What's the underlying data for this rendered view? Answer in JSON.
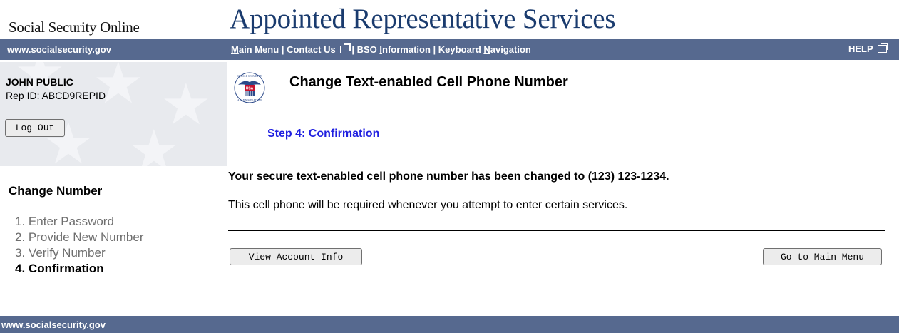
{
  "header": {
    "site_name": "Social Security Online",
    "app_title": "Appointed Representative Services"
  },
  "topbar": {
    "url": "www.socialsecurity.gov",
    "main_menu": "Main Menu",
    "contact_us": "Contact Us",
    "bso_information": "BSO Information",
    "keyboard_navigation": "Keyboard Navigation",
    "separator": "|",
    "help": "HELP"
  },
  "user": {
    "name": "JOHN PUBLIC",
    "rep_id": "Rep ID: ABCD9REPID",
    "logout_label": "Log Out"
  },
  "steps": {
    "title": "Change Number",
    "items": [
      {
        "number": "1.",
        "label": "Enter Password"
      },
      {
        "number": "2.",
        "label": "Provide New Number"
      },
      {
        "number": "3.",
        "label": "Verify Number"
      },
      {
        "number": "4.",
        "label": "Confirmation"
      }
    ]
  },
  "main": {
    "seal_text": {
      "top": "SOCIAL SECURITY",
      "bottom": "ADMINISTRATION",
      "center": "USA"
    },
    "page_title": "Change Text-enabled Cell Phone Number",
    "step_heading": "Step 4: Confirmation",
    "confirm_message": "Your secure text-enabled cell phone number has been changed to (123) 123-1234.",
    "info_message": "This cell phone will be required whenever you attempt to enter certain services.",
    "view_account_label": "View Account Info",
    "main_menu_label": "Go to Main Menu"
  },
  "footer": {
    "url": "www.socialsecurity.gov"
  },
  "colors": {
    "bar": "#56698f",
    "title": "#1a3b6e",
    "step_heading": "#1f1fe0",
    "panel": "#e8eaee"
  },
  "icons": [
    "external-link-icon",
    "ssa-seal-icon",
    "star-decoration"
  ]
}
